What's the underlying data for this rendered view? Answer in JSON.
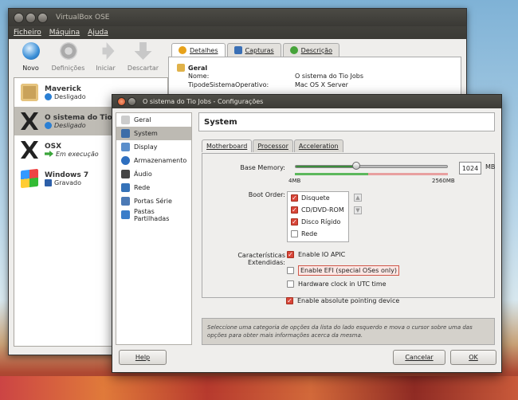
{
  "main_window": {
    "title": "VirtualBox OSE",
    "menu": [
      "Ficheiro",
      "Máquina",
      "Ajuda"
    ],
    "toolbar": [
      {
        "label": "Novo",
        "icon": "new-icon",
        "active": true
      },
      {
        "label": "Definições",
        "icon": "settings-icon",
        "active": false
      },
      {
        "label": "Iniciar",
        "icon": "start-arrow-icon",
        "active": false
      },
      {
        "label": "Descartar",
        "icon": "discard-arrow-icon",
        "active": false
      }
    ],
    "vms": [
      {
        "name": "Maverick",
        "state": "Desligado",
        "state_icon": "powered-off-icon",
        "selected": false
      },
      {
        "name": "O sistema do Tio Jobs",
        "state": "Desligado",
        "state_icon": "powered-off-icon",
        "selected": true
      },
      {
        "name": "OSX",
        "state": "Em execução",
        "state_icon": "running-icon",
        "selected": false
      },
      {
        "name": "Windows 7",
        "state": "Gravado",
        "state_icon": "saved-icon",
        "selected": false
      }
    ],
    "detail_tabs": [
      "Detalhes",
      "Capturas",
      "Descrição"
    ],
    "details": {
      "section": "Geral",
      "rows": [
        {
          "key": "Nome:",
          "value": "O sistema do Tio Jobs"
        },
        {
          "key": "TipodeSistemaOperativo:",
          "value": "Mac OS X Server"
        }
      ]
    }
  },
  "dialog": {
    "title": "O sistema do Tio Jobs - Configurações",
    "categories": [
      "Geral",
      "System",
      "Display",
      "Armazenamento",
      "Áudio",
      "Rede",
      "Portas Série",
      "Pastas Partilhadas"
    ],
    "selected_category": "System",
    "section_title": "System",
    "tabs": [
      "Motherboard",
      "Processor",
      "Acceleration"
    ],
    "base_memory_label": "Base Memory:",
    "base_memory_value": "1024",
    "base_memory_unit": "MB",
    "memory_min": "4MB",
    "memory_max": "2560MB",
    "memory_fraction": 0.4,
    "boot_order_label": "Boot Order:",
    "boot_order": [
      {
        "label": "Disquete",
        "checked": true
      },
      {
        "label": "CD/DVD-ROM",
        "checked": true
      },
      {
        "label": "Disco Rígido",
        "checked": true
      },
      {
        "label": "Rede",
        "checked": false
      }
    ],
    "extended_label": "Características Extendidas:",
    "features": [
      {
        "label": "Enable IO APIC",
        "checked": true
      },
      {
        "label": "Enable EFI (special OSes only)",
        "checked": false
      },
      {
        "label": "Hardware clock in UTC time",
        "checked": false
      },
      {
        "label": "Enable absolute pointing device",
        "checked": true
      }
    ],
    "hint": "Seleccione uma categoria de opções da lista do lado esquerdo e mova o cursor sobre uma das opções para obter mais informações acerca da mesma.",
    "help_button": "Help",
    "cancel_button": "Cancelar",
    "ok_button": "OK"
  }
}
